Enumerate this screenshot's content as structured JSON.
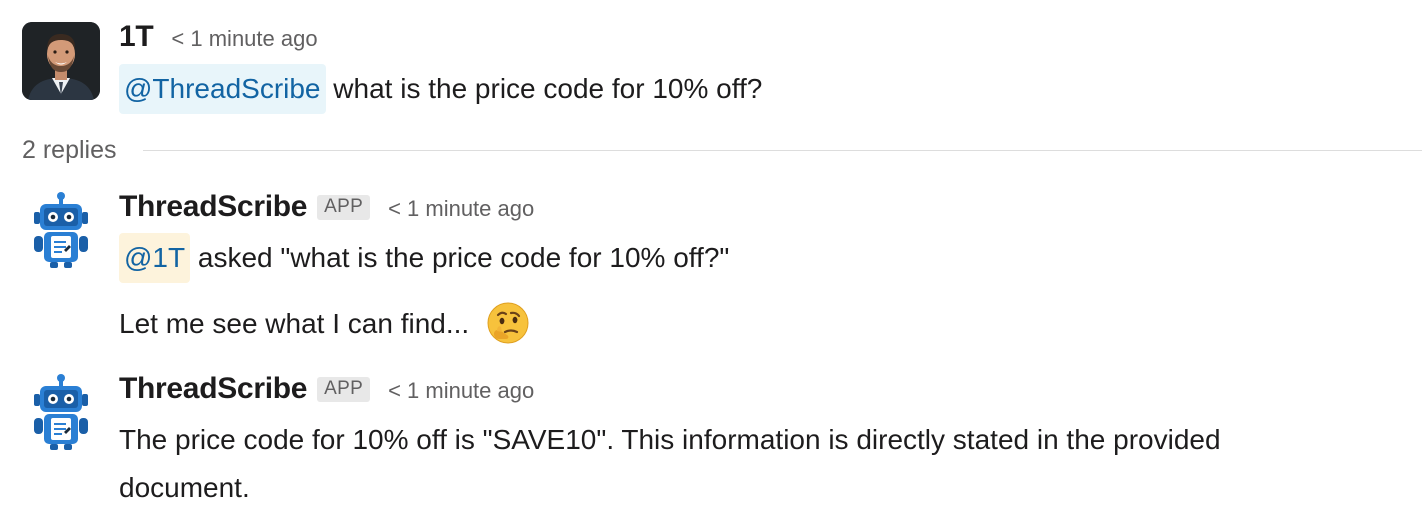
{
  "thread": {
    "parent": {
      "author": "1T",
      "time": "< 1 minute ago",
      "mention": "@ThreadScribe",
      "text": " what is the price code for 10% off?"
    },
    "replies_label": "2 replies",
    "replies": [
      {
        "author": "ThreadScribe",
        "badge": "APP",
        "time": "< 1 minute ago",
        "mention": "@1T",
        "text": " asked \"what is the price code for 10% off?\"",
        "line2": "Let me see what I can find...",
        "emoji": "thinking-face"
      },
      {
        "author": "ThreadScribe",
        "badge": "APP",
        "time": "< 1 minute ago",
        "line1": "The price code for 10% off is \"SAVE10\". This information is directly stated in the provided",
        "line2": "document."
      }
    ]
  },
  "colors": {
    "mention_text": "#1264a3",
    "mention_bg_blue": "#e8f5fa",
    "mention_bg_yellow": "#fdf3dc",
    "bot_blue": "#2a7fd4",
    "muted": "#616061"
  }
}
